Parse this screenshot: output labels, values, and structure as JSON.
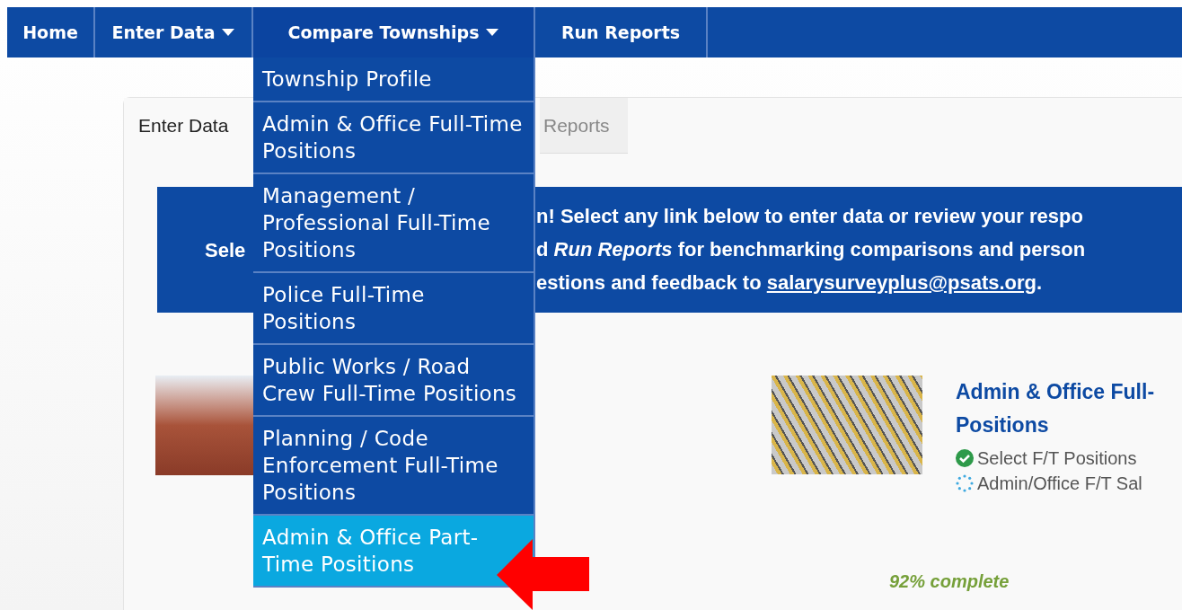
{
  "nav": [
    {
      "label": "Home",
      "has_menu": false,
      "expanded": false
    },
    {
      "label": "Enter Data",
      "has_menu": true,
      "expanded": false
    },
    {
      "label": "Compare Townships",
      "has_menu": true,
      "expanded": true
    },
    {
      "label": "Run Reports",
      "has_menu": false,
      "expanded": false
    }
  ],
  "dropdown": [
    {
      "label": "Township Profile",
      "selected": false
    },
    {
      "label": "Admin & Office Full-Time Positions",
      "selected": false
    },
    {
      "label": "Management / Professional Full-Time Positions",
      "selected": false
    },
    {
      "label": "Police Full-Time Positions",
      "selected": false
    },
    {
      "label": "Public Works / Road Crew Full-Time Positions",
      "selected": false
    },
    {
      "label": "Planning / Code Enforcement Full-Time Positions",
      "selected": false
    },
    {
      "label": "Admin & Office Part-Time Positions",
      "selected": true
    }
  ],
  "tabs": [
    {
      "label": "Enter Data",
      "selected": true
    },
    {
      "label": "Reports",
      "selected": false
    }
  ],
  "banner": {
    "left": "Sele",
    "lines": [
      "n! Select any link below to enter data or review your respo",
      "d *Run Reports* for benchmarking comparisons and person"
    ],
    "last_line": {
      "text": "estions and feedback to ",
      "link": "salarysurveyplus@psats.org",
      "after": "."
    }
  },
  "card": {
    "title_lines": [
      "Admin & Office Full-",
      "Positions"
    ],
    "steps": [
      {
        "kind": "done",
        "label": "Select F/T Positions"
      },
      {
        "kind": "pending",
        "label": "Admin/Office F/T Sal"
      }
    ],
    "progress": "92% complete"
  }
}
